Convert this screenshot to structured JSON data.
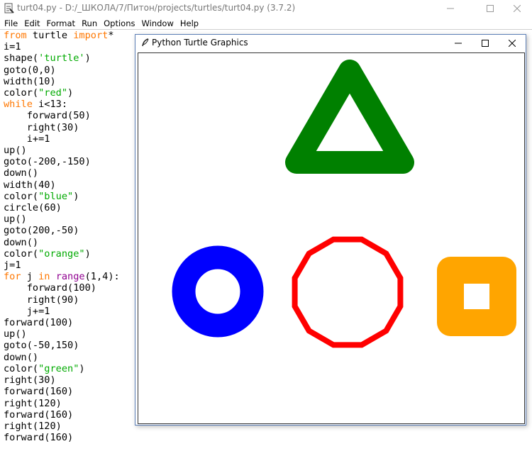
{
  "idle": {
    "title": "turt04.py - D:/_ШКОЛА/7/Питон/projects/turtles/turt04.py (3.7.2)",
    "menu": [
      "File",
      "Edit",
      "Format",
      "Run",
      "Options",
      "Window",
      "Help"
    ],
    "code_lines": [
      [
        {
          "t": "from",
          "c": "kw"
        },
        {
          "t": " turtle ",
          "c": ""
        },
        {
          "t": "import",
          "c": "kw"
        },
        {
          "t": "*",
          "c": ""
        }
      ],
      [
        {
          "t": "i=1",
          "c": ""
        }
      ],
      [
        {
          "t": "shape(",
          "c": ""
        },
        {
          "t": "'turtle'",
          "c": "str"
        },
        {
          "t": ")",
          "c": ""
        }
      ],
      [
        {
          "t": "goto(0,0)",
          "c": ""
        }
      ],
      [
        {
          "t": "width(10)",
          "c": ""
        }
      ],
      [
        {
          "t": "color(",
          "c": ""
        },
        {
          "t": "\"red\"",
          "c": "str"
        },
        {
          "t": ")",
          "c": ""
        }
      ],
      [
        {
          "t": "while",
          "c": "kw"
        },
        {
          "t": " i<13:",
          "c": ""
        }
      ],
      [
        {
          "t": "    forward(50)",
          "c": ""
        }
      ],
      [
        {
          "t": "    right(30)",
          "c": ""
        }
      ],
      [
        {
          "t": "    i+=1",
          "c": ""
        }
      ],
      [
        {
          "t": "up()",
          "c": ""
        }
      ],
      [
        {
          "t": "goto(-200,-150)",
          "c": ""
        }
      ],
      [
        {
          "t": "down()",
          "c": ""
        }
      ],
      [
        {
          "t": "width(40)",
          "c": ""
        }
      ],
      [
        {
          "t": "color(",
          "c": ""
        },
        {
          "t": "\"blue\"",
          "c": "str"
        },
        {
          "t": ")",
          "c": ""
        }
      ],
      [
        {
          "t": "circle(60)",
          "c": ""
        }
      ],
      [
        {
          "t": "up()",
          "c": ""
        }
      ],
      [
        {
          "t": "goto(200,-50)",
          "c": ""
        }
      ],
      [
        {
          "t": "down()",
          "c": ""
        }
      ],
      [
        {
          "t": "color(",
          "c": ""
        },
        {
          "t": "\"orange\"",
          "c": "str"
        },
        {
          "t": ")",
          "c": ""
        }
      ],
      [
        {
          "t": "j=1",
          "c": ""
        }
      ],
      [
        {
          "t": "for",
          "c": "kw"
        },
        {
          "t": " j ",
          "c": ""
        },
        {
          "t": "in",
          "c": "kw"
        },
        {
          "t": " ",
          "c": ""
        },
        {
          "t": "range",
          "c": "bi"
        },
        {
          "t": "(1,4):",
          "c": ""
        }
      ],
      [
        {
          "t": "    forward(100)",
          "c": ""
        }
      ],
      [
        {
          "t": "    right(90)",
          "c": ""
        }
      ],
      [
        {
          "t": "    j+=1",
          "c": ""
        }
      ],
      [
        {
          "t": "forward(100)",
          "c": ""
        }
      ],
      [
        {
          "t": "up()",
          "c": ""
        }
      ],
      [
        {
          "t": "goto(-50,150)",
          "c": ""
        }
      ],
      [
        {
          "t": "down()",
          "c": ""
        }
      ],
      [
        {
          "t": "color(",
          "c": ""
        },
        {
          "t": "\"green\"",
          "c": "str"
        },
        {
          "t": ")",
          "c": ""
        }
      ],
      [
        {
          "t": "right(30)",
          "c": ""
        }
      ],
      [
        {
          "t": "forward(160)",
          "c": ""
        }
      ],
      [
        {
          "t": "right(120)",
          "c": ""
        }
      ],
      [
        {
          "t": "forward(160)",
          "c": ""
        }
      ],
      [
        {
          "t": "right(120)",
          "c": ""
        }
      ],
      [
        {
          "t": "forward(160)",
          "c": ""
        }
      ]
    ]
  },
  "turtle_window": {
    "title": "Python Turtle Graphics"
  },
  "colors": {
    "keyword": "#ff7700",
    "builtin": "#900090",
    "string": "#00aa00",
    "triangle": "#008000",
    "circle": "#0000ff",
    "polygon": "#ff0000",
    "square": "#ffa500"
  }
}
